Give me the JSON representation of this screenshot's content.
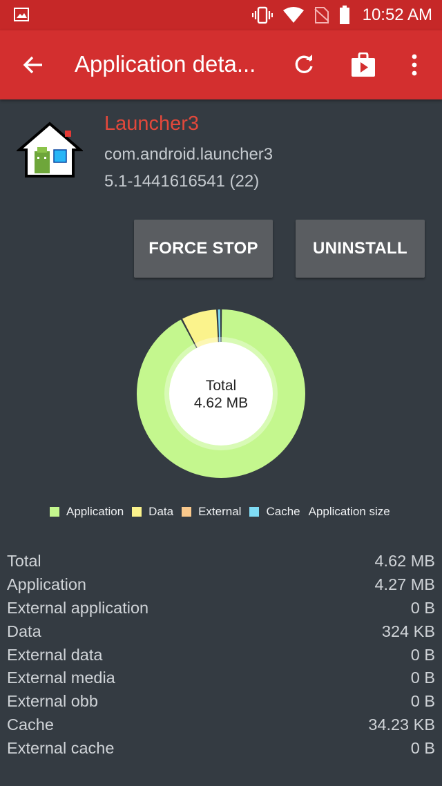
{
  "status_bar": {
    "time": "10:52 AM",
    "icons": [
      "gallery-icon",
      "vibrate-icon",
      "wifi-icon",
      "no-sim-icon",
      "battery-icon"
    ]
  },
  "toolbar": {
    "title": "Application deta...",
    "icons": [
      "back-arrow-icon",
      "refresh-icon",
      "play-store-icon",
      "more-vert-icon"
    ]
  },
  "app": {
    "name": "Launcher3",
    "package": "com.android.launcher3",
    "version": "5.1-1441616541 (22)"
  },
  "buttons": {
    "force_stop": "FORCE STOP",
    "uninstall": "UNINSTALL"
  },
  "chart_data": {
    "type": "pie",
    "center_label": [
      "Total",
      "4.62 MB"
    ],
    "categories": [
      "Application",
      "Data",
      "External",
      "Cache"
    ],
    "values": [
      4.27,
      0.324,
      0,
      0.03423
    ],
    "unit": "MB",
    "legend_extra": "Application size",
    "colors": {
      "Application": "#c4f78e",
      "Data": "#fbf38c",
      "External": "#fac98c",
      "Cache": "#7fdcf5"
    }
  },
  "sizes": [
    {
      "label": "Total",
      "value": "4.62 MB"
    },
    {
      "label": "Application",
      "value": "4.27 MB"
    },
    {
      "label": "External application",
      "value": "0 B"
    },
    {
      "label": "Data",
      "value": "324 KB"
    },
    {
      "label": "External data",
      "value": "0 B"
    },
    {
      "label": "External media",
      "value": "0 B"
    },
    {
      "label": "External obb",
      "value": "0 B"
    },
    {
      "label": "Cache",
      "value": "34.23 KB"
    },
    {
      "label": "External cache",
      "value": "0 B"
    }
  ],
  "colors": {
    "status_bar": "#c62828",
    "toolbar": "#d32f2f",
    "background": "#343b42",
    "app_name": "#e2483b",
    "button": "#5a5d61"
  }
}
